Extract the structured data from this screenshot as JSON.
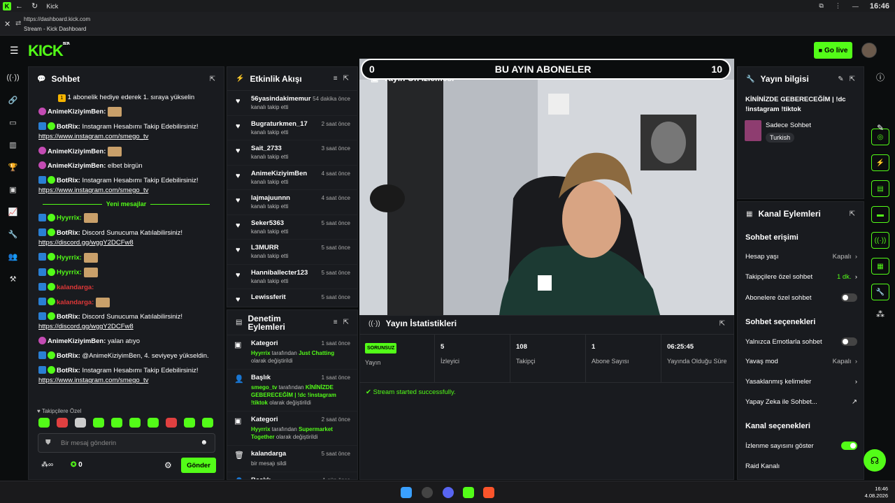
{
  "browser": {
    "tab_title": "Kick",
    "clock": "16:46",
    "url": "https://dashboard.kick.com",
    "page_title": "Stream - Kick Dashboard"
  },
  "header": {
    "logo": "KICK",
    "logo_sup": "BETA",
    "go_live": "Go live"
  },
  "chat": {
    "title": "Sohbet",
    "pinned": "1 abonelik hediye ederek 1. sıraya yükselin",
    "messages_before": [
      {
        "user": "AnimeKiziyimBen:",
        "text": "",
        "badge": "pink",
        "emote": true
      },
      {
        "user": "BotRix:",
        "text": "Instagram Hesabımı Takip Edebilirsiniz!",
        "link": "https://www.instagram.com/smego_tv",
        "badge": "bot"
      },
      {
        "user": "AnimeKiziyimBen:",
        "text": "",
        "badge": "pink",
        "emote": true
      },
      {
        "user": "AnimeKiziyimBen:",
        "text": "elbet birgün",
        "badge": "pink"
      },
      {
        "user": "BotRix:",
        "text": "Instagram Hesabımı Takip Edebilirsiniz!",
        "link": "https://www.instagram.com/smego_tv",
        "badge": "bot"
      }
    ],
    "new_messages": "Yeni mesajlar",
    "messages_after": [
      {
        "user": "Hyyrrix:",
        "text": "",
        "badge": "bot",
        "emote": true,
        "color": "#53fc18"
      },
      {
        "user": "BotRix:",
        "text": "Discord Sunucuma Katılabilirsiniz!",
        "link": "https://discord.gg/wggY2DCFw8",
        "badge": "bot"
      },
      {
        "user": "Hyyrrix:",
        "text": "",
        "badge": "bot",
        "emote": true,
        "color": "#53fc18"
      },
      {
        "user": "Hyyrrix:",
        "text": "",
        "badge": "bot",
        "emote": true,
        "color": "#53fc18"
      },
      {
        "user": "kalandarga:",
        "text": "",
        "badge": "bot",
        "emote": false,
        "color": "#e03838"
      },
      {
        "user": "kalandarga:",
        "text": "",
        "badge": "bot",
        "emote": true,
        "color": "#e03838"
      },
      {
        "user": "BotRix:",
        "text": "Discord Sunucuma Katılabilirsiniz!",
        "link": "https://discord.gg/wggY2DCFw8",
        "badge": "bot"
      },
      {
        "user": "AnimeKiziyimBen:",
        "text": "yalan atıyo",
        "badge": "pink"
      },
      {
        "user": "BotRix:",
        "text": "@AnimeKiziyimBen, 4. seviyeye yükseldin.",
        "badge": "bot"
      },
      {
        "user": "BotRix:",
        "text": "Instagram Hesabımı Takip Edebilirsiniz!",
        "link": "https://www.instagram.com/smego_tv",
        "badge": "bot"
      }
    ],
    "followers_only": "Takipçilere Özel",
    "input_placeholder": "Bir mesaj gönderin",
    "points_value": "0",
    "send": "Gönder"
  },
  "activity": {
    "title": "Etkinlik Akışı",
    "items": [
      {
        "name": "56yasindakimemur",
        "sub": "kanalı takip etti",
        "time": "54 dakika önce"
      },
      {
        "name": "Bugraturkmen_17",
        "sub": "kanalı takip etti",
        "time": "2 saat önce"
      },
      {
        "name": "Sait_2733",
        "sub": "kanalı takip etti",
        "time": "3 saat önce"
      },
      {
        "name": "AnimeKiziyimBen",
        "sub": "kanalı takip etti",
        "time": "4 saat önce"
      },
      {
        "name": "lajmajuunnn",
        "sub": "kanalı takip etti",
        "time": "4 saat önce"
      },
      {
        "name": "Seker5363",
        "sub": "kanalı takip etti",
        "time": "5 saat önce"
      },
      {
        "name": "L3MURR",
        "sub": "kanalı takip etti",
        "time": "5 saat önce"
      },
      {
        "name": "Hanniballecter123",
        "sub": "kanalı takip etti",
        "time": "5 saat önce"
      },
      {
        "name": "Lewissferit",
        "sub": "",
        "time": "5 saat önce"
      }
    ]
  },
  "moderation": {
    "title_line1": "Denetim",
    "title_line2": "Eylemleri",
    "items": [
      {
        "title": "Kategori",
        "time": "1 saat önce",
        "actor": "Hyyrrix",
        "mid": " tarafından ",
        "target": "Just Chatting",
        "end": " olarak değiştirildi"
      },
      {
        "title": "Başlık",
        "time": "1 saat önce",
        "actor": "smego_tv",
        "mid": " tarafından ",
        "target": "KİNİNİZDE GEBERECEĞİM | !dc !instagram !tiktok",
        "end": " olarak değiştirildi"
      },
      {
        "title": "Kategori",
        "time": "2 saat önce",
        "actor": "Hyyrrix",
        "mid": " tarafından ",
        "target": "Supermarket Together",
        "end": " olarak değiştirildi"
      },
      {
        "title": "kalandarga",
        "time": "5 saat önce",
        "actor": "",
        "mid": "bir mesajı sildi",
        "target": "",
        "end": ""
      },
      {
        "title": "Başlık",
        "time": "1 gün önce",
        "actor": "",
        "mid": "",
        "target": "",
        "end": ""
      }
    ]
  },
  "preview": {
    "title": "Yayın Ön İzlemesi",
    "score_left": "0",
    "score_title": "BU AYIN ABONELER",
    "score_right": "10"
  },
  "stats": {
    "title": "Yayın İstatistikleri",
    "status_badge": "SORUNSUZ",
    "status_label": "Yayın",
    "items": [
      {
        "value": "5",
        "label": "İzleyici"
      },
      {
        "value": "108",
        "label": "Takipçi"
      },
      {
        "value": "1",
        "label": "Abone Sayısı"
      },
      {
        "value": "06:25:45",
        "label": "Yayında Olduğu Süre"
      }
    ],
    "message": "Stream started successfully."
  },
  "info": {
    "title": "Yayın bilgisi",
    "stream_title": "KİNİNİZDE GEBERECEĞİM | !dc !instagram !tiktok",
    "category": "Sadece Sohbet",
    "language": "Turkish"
  },
  "actions": {
    "title": "Kanal Eylemleri",
    "chat_access": "Sohbet erişimi",
    "account_age": "Hesap yaşı",
    "account_age_val": "Kapalı",
    "followers_chat": "Takipçilere özel sohbet",
    "followers_chat_val": "1 dk.",
    "subs_chat": "Abonelere özel sohbet",
    "chat_options": "Sohbet seçenekleri",
    "emote_only": "Yalnızca Emotlarla sohbet",
    "slow_mode": "Yavaş mod",
    "slow_mode_val": "Kapalı",
    "banned_words": "Yasaklanmış kelimeler",
    "ai_chat": "Yapay Zeka ile Sohbet...",
    "channel_options": "Kanal seçenekleri",
    "show_views": "İzlenme sayısını göster",
    "raid": "Raid Kanalı"
  },
  "taskbar": {
    "time": "16:46",
    "date": "4.08.2026"
  }
}
